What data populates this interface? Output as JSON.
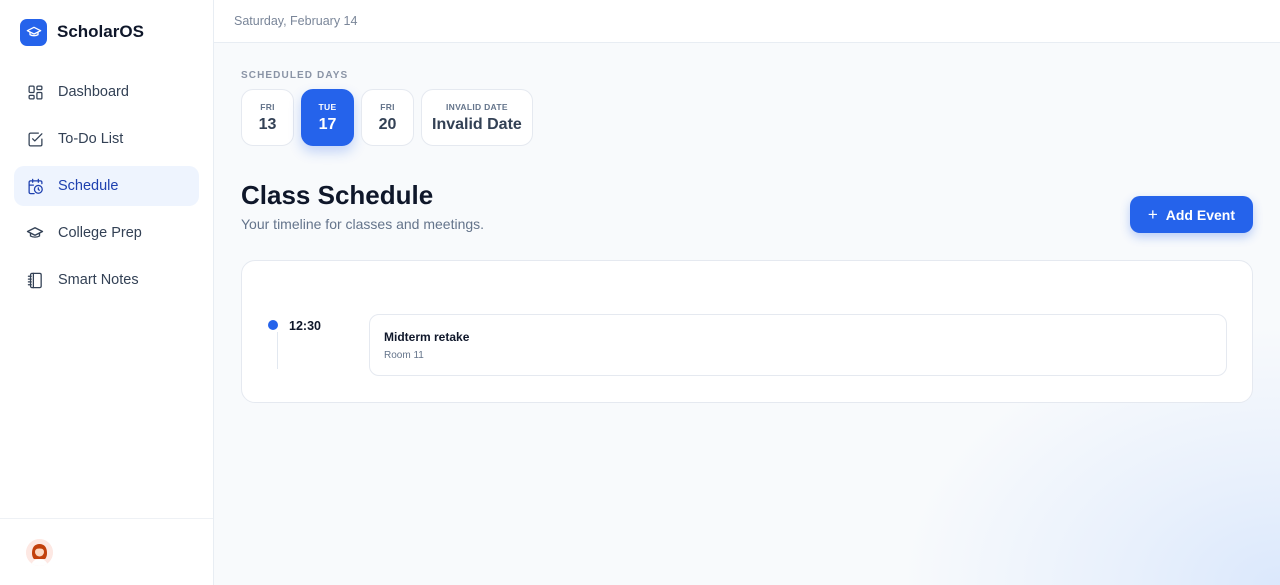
{
  "app": {
    "name": "ScholarOS",
    "accent": "#2563eb"
  },
  "sidebar": {
    "items": [
      {
        "label": "Dashboard",
        "icon": "grid-icon",
        "active": false
      },
      {
        "label": "To-Do List",
        "icon": "checkbox-icon",
        "active": false
      },
      {
        "label": "Schedule",
        "icon": "calendar-clock-icon",
        "active": true
      },
      {
        "label": "College Prep",
        "icon": "graduation-cap-icon",
        "active": false
      },
      {
        "label": "Smart Notes",
        "icon": "notebook-icon",
        "active": false
      }
    ],
    "footer": {
      "avatar_icon": "user-avatar"
    }
  },
  "topbar": {
    "date": "Saturday, February 14"
  },
  "scheduled_days": {
    "label": "SCHEDULED DAYS",
    "days": [
      {
        "dow": "FRI",
        "num": "13",
        "active": false
      },
      {
        "dow": "TUE",
        "num": "17",
        "active": true
      },
      {
        "dow": "FRI",
        "num": "20",
        "active": false
      },
      {
        "dow": "INVALID DATE",
        "num": "Invalid Date",
        "active": false
      }
    ]
  },
  "header": {
    "title": "Class Schedule",
    "subtitle": "Your timeline for classes and meetings.",
    "add_button": "Add Event",
    "add_icon": "+"
  },
  "timeline": {
    "events": [
      {
        "time": "12:30",
        "title": "Midterm retake",
        "room": "Room 11"
      }
    ]
  }
}
